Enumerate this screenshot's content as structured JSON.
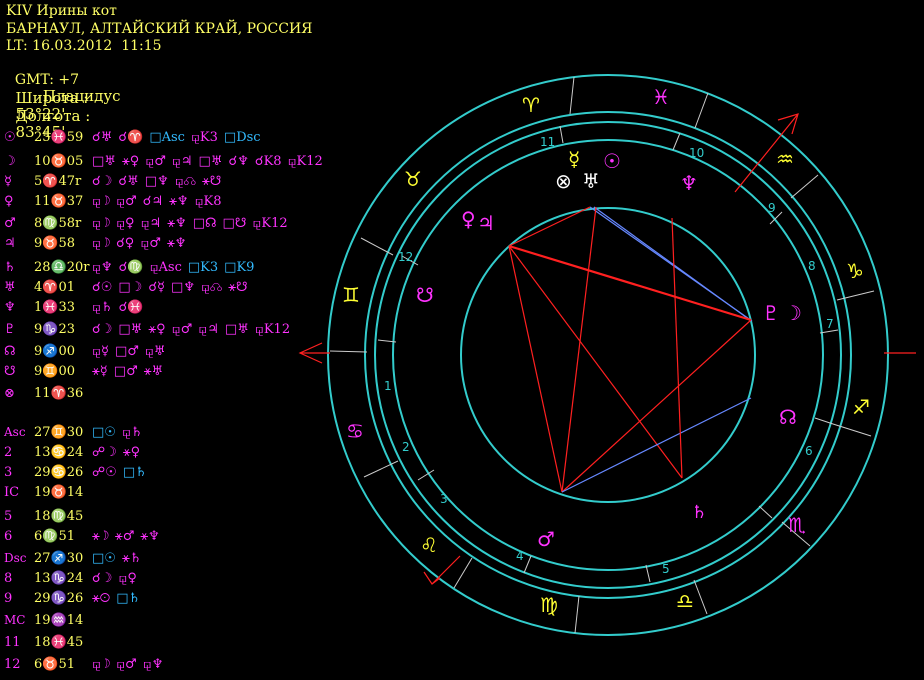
{
  "header": {
    "title": "KIV Ирины кот",
    "place": "БАРНАУЛ, АЛТАЙСКИЙ КРАЙ, РОССИЯ",
    "lt": "LT: 16.03.2012  11:15",
    "gmt": "GMT: +7",
    "house_system": "Плацидус",
    "lat_label": "Широта :",
    "lat_value": "53°22'",
    "lon_label": "Долгота :",
    "lon_value": "83°45'"
  },
  "planets": [
    {
      "glyph": "☉",
      "pos": "25♓59",
      "aspects": [
        "☌♅",
        "☌♈",
        "□Asc",
        "⚼K3",
        "□Dsc"
      ]
    },
    {
      "glyph": "☽",
      "pos": "10♉05",
      "aspects": [
        "□♅",
        "⚹♀",
        "⚼♂",
        "⚼♃",
        "□♅",
        "☌♆",
        "☌K8",
        "⚼K12"
      ]
    },
    {
      "glyph": "☿",
      "pos": "5♈47r",
      "aspects": [
        "☌☽",
        "☌♅",
        "□♆",
        "⚼☊",
        "⚹☋"
      ]
    },
    {
      "glyph": "♀",
      "pos": "11♉37",
      "aspects": [
        "⚼☽",
        "⚼♂",
        "☌♃",
        "⚹♆",
        "⚼K8"
      ]
    },
    {
      "glyph": "♂",
      "pos": "8♍58r",
      "aspects": [
        "⚼☽",
        "⚼♀",
        "⚼♃",
        "⚹♆",
        "□☊",
        "□☋",
        "⚼K12"
      ]
    },
    {
      "glyph": "♃",
      "pos": "9♉58",
      "aspects": [
        "⚼☽",
        "☌♀",
        "⚼♂",
        "⚹♆"
      ]
    },
    {
      "glyph": "♄",
      "pos": "28♎20r",
      "aspects": [
        "⚼♆",
        "☌♍",
        "⚼Asc",
        "□K3",
        "□K9"
      ]
    },
    {
      "glyph": "♅",
      "pos": "4♈01",
      "aspects": [
        "☌☉",
        "□☽",
        "☌☿",
        "□♆",
        "⚼☊",
        "⚹☋"
      ]
    },
    {
      "glyph": "♆",
      "pos": "1♓33",
      "aspects": [
        "⚼♄",
        "☌♓"
      ]
    },
    {
      "glyph": "♇",
      "pos": "9♑23",
      "aspects": [
        "☌☽",
        "□♅",
        "⚹♀",
        "⚼♂",
        "⚼♃",
        "□♅",
        "⚼K12"
      ]
    },
    {
      "glyph": "☊",
      "pos": "9♐00",
      "aspects": [
        "⚼☿",
        "□♂",
        "⚼♅"
      ]
    },
    {
      "glyph": "☋",
      "pos": "9♊00",
      "aspects": [
        "⚹☿",
        "□♂",
        "⚹♅"
      ]
    },
    {
      "glyph": "⊗",
      "pos": "11♈36",
      "aspects": []
    }
  ],
  "houses": [
    {
      "label": "Asc",
      "pos": "27♊30",
      "aspects": [
        "□☉",
        "⚼♄"
      ]
    },
    {
      "label": "2",
      "pos": "13♋24",
      "aspects": [
        "☍☽",
        "⚹♀"
      ]
    },
    {
      "label": "3",
      "pos": "29♋26",
      "aspects": [
        "☍☉",
        "□♄"
      ]
    },
    {
      "label": "IC",
      "pos": "19♉14",
      "aspects": []
    },
    {
      "label": "5",
      "pos": "18♍45",
      "aspects": []
    },
    {
      "label": "6",
      "pos": "6♍51",
      "aspects": [
        "⚹☽",
        "⚹♂",
        "⚹♆"
      ]
    },
    {
      "label": "Dsc",
      "pos": "27♐30",
      "aspects": [
        "□☉",
        "⚹♄"
      ]
    },
    {
      "label": "8",
      "pos": "13♑24",
      "aspects": [
        "☌☽",
        "⚼♀"
      ]
    },
    {
      "label": "9",
      "pos": "29♑26",
      "aspects": [
        "⚹☉",
        "□♄"
      ]
    },
    {
      "label": "MC",
      "pos": "19♒14",
      "aspects": []
    },
    {
      "label": "11",
      "pos": "18♓45",
      "aspects": []
    },
    {
      "label": "12",
      "pos": "6♉51",
      "aspects": [
        "⚼☽",
        "⚼♂",
        "⚼♆"
      ]
    }
  ],
  "wheel": {
    "signs": [
      "♈",
      "♓",
      "♒",
      "♑",
      "♐",
      "♏",
      "♎",
      "♍",
      "♌",
      "♋",
      "♊",
      "♉"
    ],
    "house_numbers": [
      "1",
      "2",
      "3",
      "4",
      "5",
      "6",
      "7",
      "8",
      "9",
      "10",
      "11",
      "12"
    ],
    "chart_planets": [
      "☿",
      "☉",
      "⊗",
      "♅",
      "♆",
      "♀",
      "♃",
      "☋",
      "♇",
      "☽",
      "☊",
      "♄",
      "♂"
    ]
  },
  "colors": {
    "header": "#ffff66",
    "magenta": "#ff33ff",
    "cyan": "#33cccc",
    "red": "#ff2020",
    "blue": "#6688ff"
  }
}
